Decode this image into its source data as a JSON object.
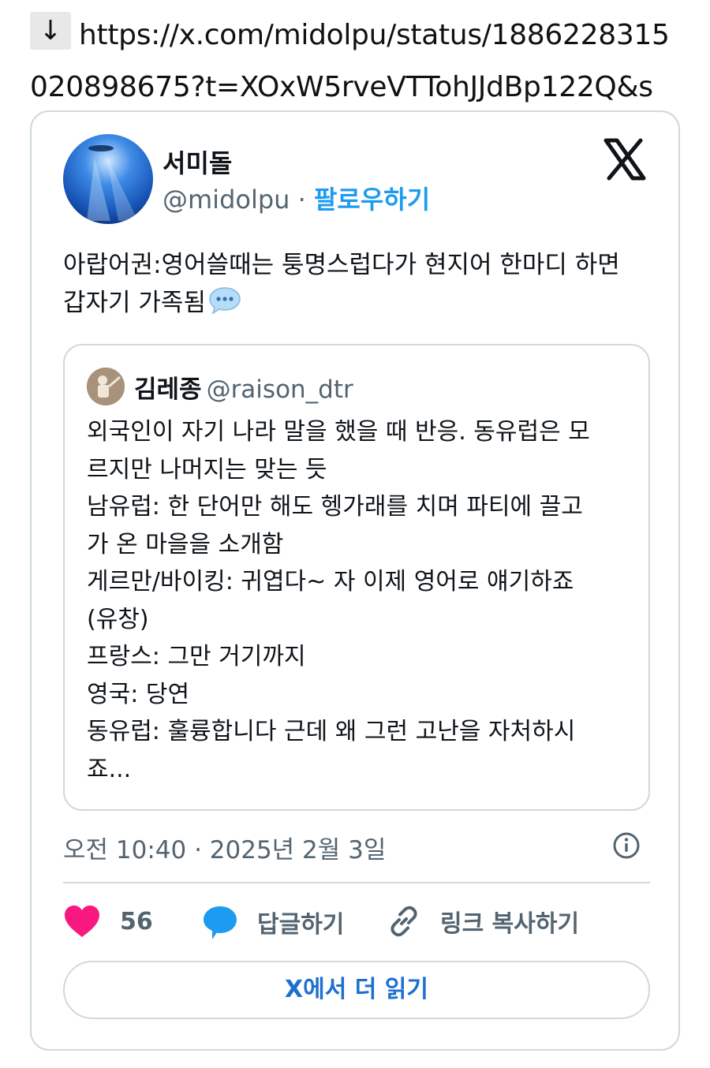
{
  "url": {
    "arrow": "↓",
    "line1": "https://x.com/midolpu/status/1886228315",
    "line2": "020898675?t=XOxW5rveVTTohJJdBp122Q&s"
  },
  "tweet": {
    "display_name": "서미돌",
    "handle": "@midolpu",
    "separator": "·",
    "follow_label": "팔로우하기",
    "text_line1": "아랍어권:영어쓸때는 퉁명스럽다가 현지어 한마디 하면",
    "text_line2": "갑자기 가족됨",
    "timestamp": "오전 10:40 · 2025년 2월 3일",
    "likes": "56",
    "reply_label": "답글하기",
    "copy_link_label": "링크 복사하기",
    "read_more_label": "X에서 더 읽기"
  },
  "quote": {
    "display_name": "김레종",
    "handle": "@raison_dtr",
    "lines": [
      "외국인이 자기 나라 말을 했을 때 반응. 동유럽은 모",
      "르지만 나머지는 맞는 듯",
      "남유럽: 한 단어만 해도 헹가래를 치며 파티에 끌고",
      "가 온 마을을 소개함",
      "게르만/바이킹: 귀엽다~ 자 이제 영어로 얘기하죠",
      "(유창)",
      "프랑스: 그만 거기까지",
      "영국: 당연",
      "동유럽: 훌륭합니다 근데 왜 그런 고난을 자처하시",
      "죠..."
    ]
  },
  "colors": {
    "accent": "#1d9bf0",
    "like": "#f91880",
    "muted": "#536471",
    "border": "#cfd9de"
  },
  "icons": [
    "down-arrow-icon",
    "x-logo-icon",
    "speech-bubble-icon",
    "info-icon",
    "heart-icon",
    "reply-bubble-icon",
    "link-icon"
  ]
}
